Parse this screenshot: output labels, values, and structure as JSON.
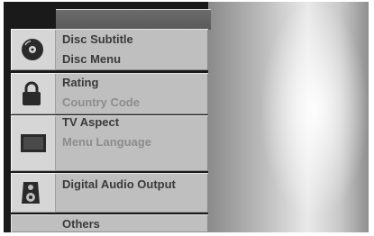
{
  "title_bar": "",
  "groups": [
    {
      "icon": "disc-icon",
      "items": [
        {
          "label": "Disc Subtitle",
          "dim": false
        },
        {
          "label": "Disc Menu",
          "dim": false
        }
      ]
    },
    {
      "icon": "lock-icon",
      "items": [
        {
          "label": "Rating",
          "dim": false
        },
        {
          "label": "Country Code",
          "dim": true
        }
      ]
    },
    {
      "icon": "tv-screen-icon",
      "items": [
        {
          "label": "TV Aspect",
          "dim": false
        },
        {
          "label": "Menu Language",
          "dim": true
        }
      ]
    },
    {
      "icon": "speaker-icon",
      "items": [
        {
          "label": "Digital Audio Output",
          "dim": false
        }
      ]
    },
    {
      "icon": "",
      "items": [
        {
          "label": "Others",
          "dim": false
        }
      ]
    }
  ]
}
